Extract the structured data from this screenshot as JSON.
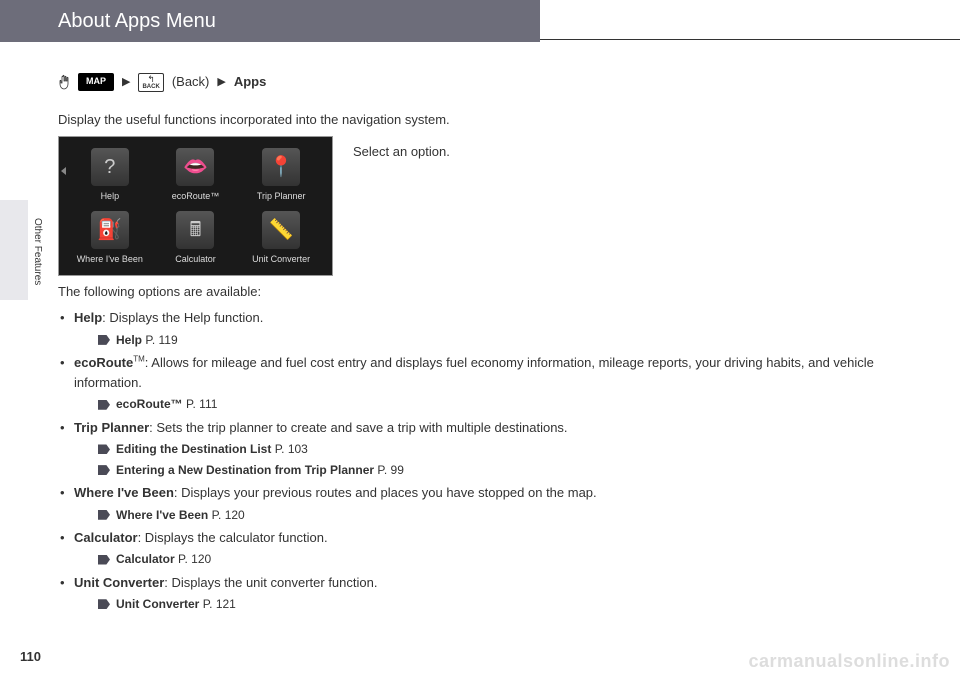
{
  "header": {
    "title": "About Apps Menu"
  },
  "sidebar": {
    "section": "Other Features"
  },
  "breadcrumb": {
    "map_label": "MAP",
    "back_label": "(Back)",
    "back_btn_text": "BACK",
    "apps_label": "Apps"
  },
  "intro": "Display the useful functions incorporated into the navigation system.",
  "instruction": "Select an option.",
  "screenshot": {
    "apps": [
      {
        "label": "Help",
        "glyph": "?"
      },
      {
        "label": "ecoRoute™",
        "glyph": "👄"
      },
      {
        "label": "Trip Planner",
        "glyph": "📍"
      },
      {
        "label": "Where I've Been",
        "glyph": "⛽"
      },
      {
        "label": "Calculator",
        "glyph": "🖩"
      },
      {
        "label": "Unit Converter",
        "glyph": "📏"
      }
    ]
  },
  "options_intro": "The following options are available:",
  "options": [
    {
      "title": "Help",
      "desc": ": Displays the Help function.",
      "refs": [
        {
          "text": "Help",
          "page": "P. 119"
        }
      ]
    },
    {
      "title": "ecoRoute",
      "title_sup": "TM",
      "desc": ": Allows for mileage and fuel cost entry and displays fuel economy information, mileage reports, your driving habits, and vehicle information.",
      "refs": [
        {
          "text": "ecoRoute™",
          "page": "P. 111"
        }
      ]
    },
    {
      "title": "Trip Planner",
      "desc": ": Sets the trip planner to create and save a trip with multiple destinations.",
      "refs": [
        {
          "text": "Editing the Destination List",
          "page": "P. 103"
        },
        {
          "text": "Entering a New Destination from Trip Planner",
          "page": "P. 99"
        }
      ]
    },
    {
      "title": "Where I've Been",
      "desc": ": Displays your previous routes and places you have stopped on the map.",
      "refs": [
        {
          "text": "Where I've Been",
          "page": "P. 120"
        }
      ]
    },
    {
      "title": "Calculator",
      "desc": ": Displays the calculator function.",
      "refs": [
        {
          "text": "Calculator",
          "page": "P. 120"
        }
      ]
    },
    {
      "title": "Unit Converter",
      "desc": ": Displays the unit converter function.",
      "refs": [
        {
          "text": "Unit Converter",
          "page": "P. 121"
        }
      ]
    }
  ],
  "page_number": "110",
  "watermark": "carmanualsonline.info"
}
